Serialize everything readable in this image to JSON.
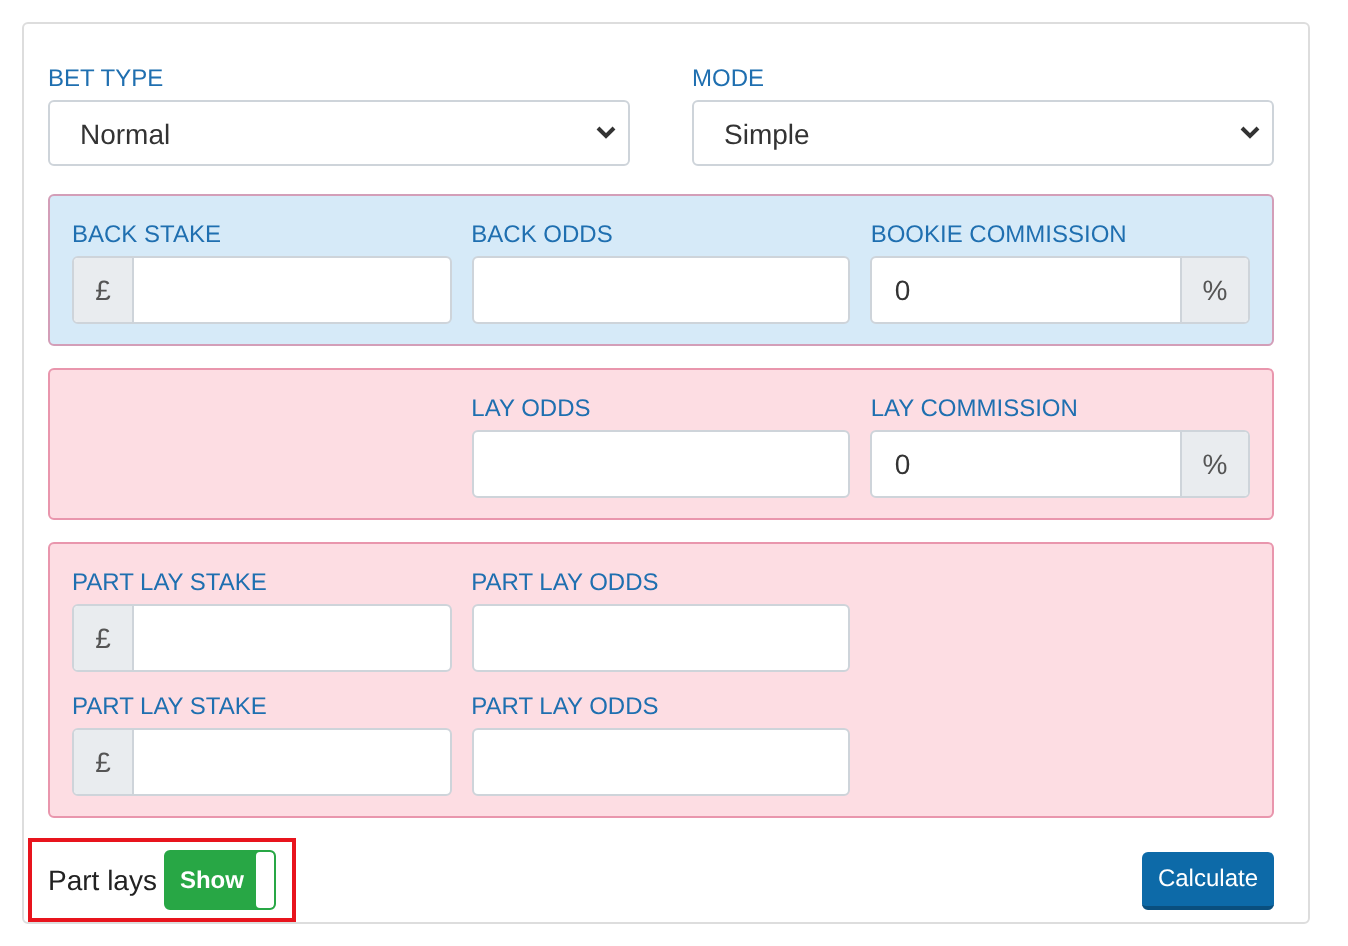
{
  "selects": [
    {
      "label": "BET TYPE",
      "value": "Normal"
    },
    {
      "label": "MODE",
      "value": "Simple"
    }
  ],
  "panels": [
    {
      "color": "#d6eaf8",
      "rows": [
        [
          {
            "kind": "field",
            "label": "BACK STAKE",
            "prefix": "£"
          },
          {
            "kind": "field",
            "label": "BACK ODDS"
          },
          {
            "kind": "field",
            "label": "BOOKIE COMMISSION",
            "value": "0",
            "suffix": "%"
          }
        ]
      ]
    },
    {
      "color": "#fddde3",
      "rows": [
        [
          {
            "kind": "empty"
          },
          {
            "kind": "field",
            "label": "LAY ODDS"
          },
          {
            "kind": "field",
            "label": "LAY COMMISSION",
            "value": "0",
            "suffix": "%"
          }
        ]
      ]
    },
    {
      "color": "#fddde3",
      "rows": [
        [
          {
            "kind": "field",
            "label": "PART LAY STAKE",
            "prefix": "£"
          },
          {
            "kind": "field",
            "label": "PART LAY ODDS"
          }
        ],
        [
          {
            "kind": "field",
            "label": "PART LAY STAKE",
            "prefix": "£"
          },
          {
            "kind": "field",
            "label": "PART LAY ODDS"
          }
        ]
      ]
    }
  ],
  "part_lays": {
    "label": "Part lays",
    "toggle_text": "Show",
    "on": true,
    "highlighted": true
  },
  "button": "Calculate"
}
